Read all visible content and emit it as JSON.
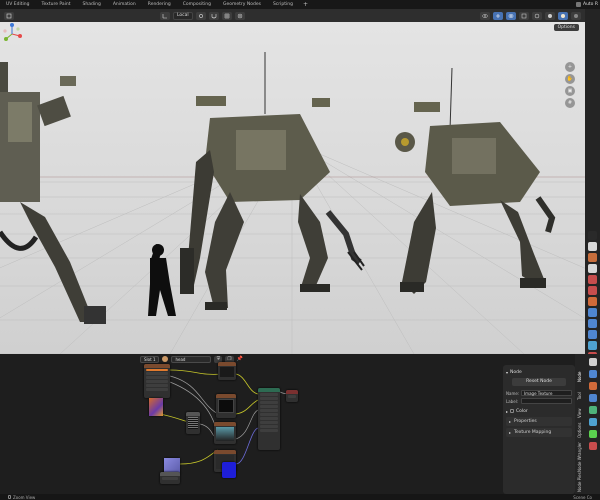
{
  "topbar": {
    "tabs": [
      "UV Editing",
      "Texture Paint",
      "Shading",
      "Animation",
      "Rendering",
      "Compositing",
      "Geometry Nodes",
      "Scripting"
    ],
    "active_tab_index": -1,
    "plus": "+",
    "scene_label": "Auto R"
  },
  "viewport_header": {
    "orientation_value": "Local"
  },
  "viewport": {
    "options_label": "Options",
    "gizmo_axes": {
      "x": "#e54a4a",
      "y": "#79b42f",
      "z": "#3c78d8"
    }
  },
  "node_editor": {
    "slot_value": "Slot 1",
    "material_value": "head"
  },
  "npanel": {
    "section_title": "Node",
    "reset_button": "Reset Node",
    "name_label": "Name:",
    "name_value": "Image Texture",
    "label_label": "Label:",
    "label_value": "",
    "color_label": "Color",
    "properties_label": "Properties",
    "texture_mapping_label": "Texture Mapping"
  },
  "npanel_tabs": [
    "Node",
    "Tool",
    "View",
    "Options",
    "Node Wrangler",
    "Node Pies"
  ],
  "statusbar": {
    "left": "Zoom View",
    "right": "Scene Co"
  },
  "colors": {
    "viewport_bg": "#d6d6d6",
    "accent": "#4772b3",
    "shader_link": "#c7c72a",
    "image_node_header": "#7a4a2e",
    "shader_node_header": "#2d6b52"
  }
}
